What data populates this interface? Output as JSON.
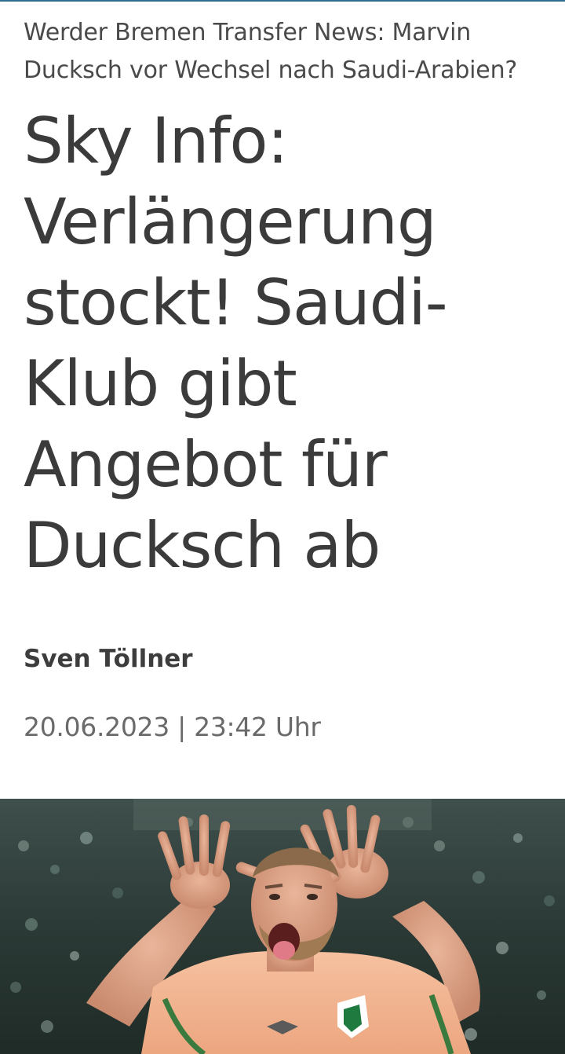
{
  "article": {
    "kicker": "Werder Bremen Transfer News: Marvin Ducksch vor Wechsel nach Saudi-Arabien?",
    "headline": "Sky Info: Verlängerung stockt! Saudi-Klub gibt Angebot für Ducksch ab",
    "author": "Sven Töllner",
    "dateline": "20.06.2023 | 23:42 Uhr"
  },
  "hero_image": {
    "icon": "player-celebration-photo"
  },
  "colors": {
    "top_rule": "#2b6c8f",
    "text_primary": "#3b3b3b",
    "text_secondary": "#6a6a6a",
    "jersey": "#f2b38f"
  }
}
